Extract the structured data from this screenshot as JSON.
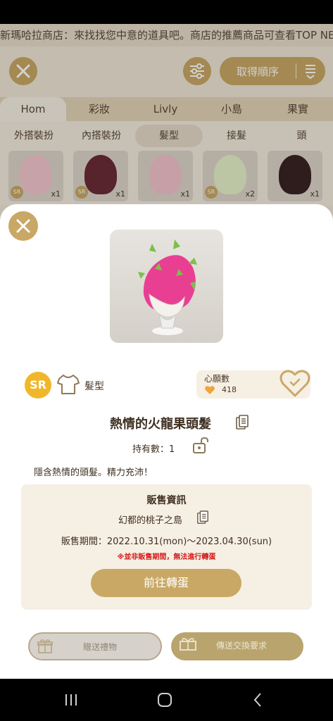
{
  "ticker": {
    "text": "新瑪哈拉商店：來找找您中意的道具吧。商店的推薦商品可查看TOP NEW"
  },
  "toolbar": {
    "sort_label": "取得順序"
  },
  "category_tabs": [
    "Hom",
    "彩妝",
    "Livly",
    "小島",
    "果實"
  ],
  "sub_tabs": [
    "外搭裝扮",
    "內搭裝扮",
    "髮型",
    "接髮",
    "頭"
  ],
  "grid_items": [
    {
      "rarity": "SR",
      "qty": "x1",
      "color": "#f3c6cf"
    },
    {
      "rarity": "SR",
      "qty": "x1",
      "color": "#6b2b36"
    },
    {
      "rarity": "",
      "qty": "x1",
      "color": "#f2c3cc"
    },
    {
      "rarity": "SR",
      "qty": "x2",
      "color": "#e6f2c8"
    },
    {
      "rarity": "",
      "qty": "x1",
      "color": "#3a2424"
    }
  ],
  "modal": {
    "rarity": "SR",
    "type_label": "髮型",
    "wish_label": "心願數",
    "wish_count": "418",
    "item_name": "熱情的火龍果頭髮",
    "own_count": "持有數：1",
    "description": "隱含熱情的頭髮。精力充沛！",
    "sale": {
      "title": "販售資訊",
      "island": "幻都的桃子之島",
      "period": "販售期間：2022.10.31(mon)～2023.04.30(sun)",
      "warning": "※並非販售期間，無法進行轉蛋",
      "go_label": "前往轉蛋"
    },
    "gift_label": "贈送禮物",
    "trade_label": "傳送交換要求"
  },
  "colors": {
    "accent": "#c9a865",
    "rarity": "#f1b72a",
    "warning": "#d21a1a"
  }
}
